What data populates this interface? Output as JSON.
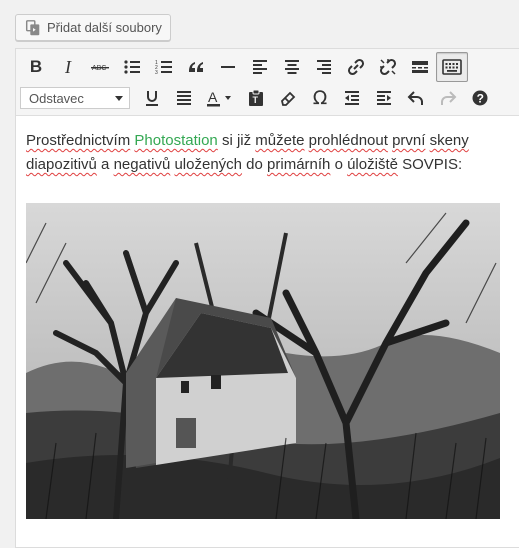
{
  "media": {
    "add_files_label": "Přidat další soubory"
  },
  "toolbar": {
    "row1": [
      {
        "name": "bold-button",
        "icon": "bold"
      },
      {
        "name": "italic-button",
        "icon": "italic"
      },
      {
        "name": "strikethrough-button",
        "icon": "strikethrough"
      },
      {
        "name": "bullet-list-button",
        "icon": "bullet-list"
      },
      {
        "name": "numbered-list-button",
        "icon": "numbered-list"
      },
      {
        "name": "blockquote-button",
        "icon": "blockquote"
      },
      {
        "name": "horizontal-line-button",
        "icon": "horizontal-line"
      },
      {
        "name": "align-left-button",
        "icon": "align-left"
      },
      {
        "name": "align-center-button",
        "icon": "align-center"
      },
      {
        "name": "align-right-button",
        "icon": "align-right"
      },
      {
        "name": "insert-link-button",
        "icon": "link"
      },
      {
        "name": "remove-link-button",
        "icon": "unlink"
      },
      {
        "name": "read-more-button",
        "icon": "read-more"
      },
      {
        "name": "toolbar-toggle-button",
        "icon": "keyboard",
        "active": true
      }
    ],
    "format_select": {
      "value": "Odstavec"
    },
    "row2": [
      {
        "name": "underline-button",
        "icon": "underline"
      },
      {
        "name": "justify-button",
        "icon": "justify"
      },
      {
        "name": "text-color-button",
        "icon": "text-color"
      },
      {
        "name": "paste-text-button",
        "icon": "paste-text"
      },
      {
        "name": "clear-formatting-button",
        "icon": "eraser"
      },
      {
        "name": "special-character-button",
        "icon": "omega"
      },
      {
        "name": "outdent-button",
        "icon": "outdent"
      },
      {
        "name": "indent-button",
        "icon": "indent"
      },
      {
        "name": "undo-button",
        "icon": "undo"
      },
      {
        "name": "redo-button",
        "icon": "redo",
        "disabled": true
      },
      {
        "name": "help-button",
        "icon": "help"
      }
    ]
  },
  "content": {
    "t1": "Prostřednictvím",
    "t2": " ",
    "link": "Photostation",
    "t3": " si již ",
    "t4": "můžete",
    "t5": " ",
    "t6": "prohlédnout",
    "t7": " ",
    "t8": "první",
    "t9": " ",
    "t10": "skeny",
    "t11": " ",
    "t12": "diapozitivů",
    "t13": " a ",
    "t14": "negativů",
    "t15": " ",
    "t16": "uložených",
    "t17": " do ",
    "t18": "primárníh",
    "t19": " o ",
    "t20": "úložiště",
    "t21": " SOVPIS:",
    "link_color": "#34a853"
  }
}
